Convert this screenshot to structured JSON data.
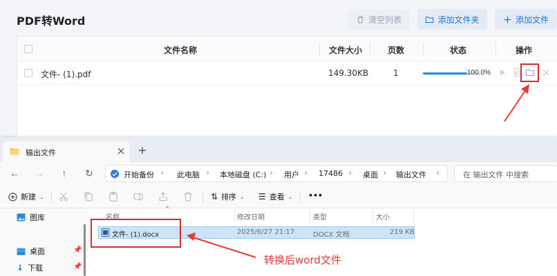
{
  "app": {
    "title": "PDF转Word",
    "toolbar": {
      "clear_label": "清空列表",
      "add_folder_label": "添加文件夹",
      "add_file_label": "添加文件"
    },
    "columns": [
      "文件名称",
      "文件大小",
      "页数",
      "状态",
      "操作"
    ],
    "rows": [
      {
        "name": "文件- (1).pdf",
        "size": "149.30KB",
        "pages": "1",
        "progress": 1.0,
        "status": "100.0%"
      }
    ],
    "accent": "#1976d2"
  },
  "explorer": {
    "tab_title": "输出文件",
    "breadcrumb": [
      "开始备份",
      "此电脑",
      "本地磁盘 (C:)",
      "用户",
      "17486",
      "桌面",
      "输出文件"
    ],
    "search_placeholder": "在 输出文件 中搜索",
    "commands": {
      "new_label": "新建",
      "sort_label": "排序",
      "view_label": "查看",
      "more_label": "•••"
    },
    "sidebar": [
      {
        "label": "图库",
        "icon": "gallery-icon"
      },
      {
        "label": "桌面",
        "icon": "desktop-icon",
        "pinned": true
      },
      {
        "label": "下载",
        "icon": "download-icon",
        "pinned": true
      }
    ],
    "columns": [
      "名称",
      "修改日期",
      "类型",
      "大小"
    ],
    "files": [
      {
        "name": "文件- (1).docx",
        "modified": "2025/6/27 21:17",
        "type": "DOCX 文档",
        "size": "219 KB"
      }
    ]
  },
  "annotation": {
    "text": "转换后word文件",
    "color": "#e53935"
  }
}
